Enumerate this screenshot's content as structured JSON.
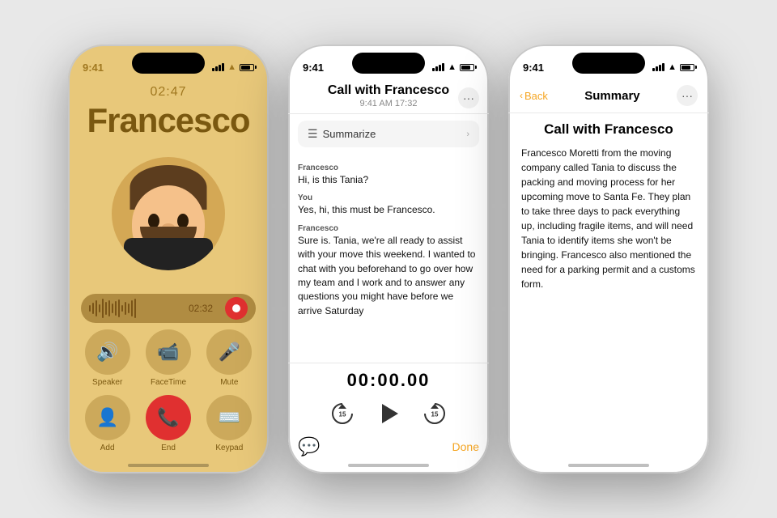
{
  "phone1": {
    "status_time": "9:41",
    "call_duration": "02:47",
    "caller_name": "Francesco",
    "timer": "02:32",
    "buttons": [
      {
        "icon": "🔊",
        "label": "Speaker"
      },
      {
        "icon": "📹",
        "label": "FaceTime"
      },
      {
        "icon": "🎤",
        "label": "Mute"
      },
      {
        "icon": "👤",
        "label": "Add"
      },
      {
        "icon": "📞",
        "label": "End",
        "type": "end"
      },
      {
        "icon": "⌨️",
        "label": "Keypad"
      }
    ]
  },
  "phone2": {
    "status_time": "9:41",
    "title": "Call with Francesco",
    "subtitle": "9:41 AM  17:32",
    "summarize_label": "Summarize",
    "transcript": [
      {
        "speaker": "Francesco",
        "text": "Hi, is this Tania?"
      },
      {
        "speaker": "You",
        "text": "Yes, hi, this must be Francesco."
      },
      {
        "speaker": "Francesco",
        "text": "Sure is. Tania, we're all ready to assist with your move this weekend. I wanted to chat with you beforehand to go over how my team and I work and to answer any questions you might have before we arrive Saturday"
      }
    ],
    "playback_time": "00:00.00",
    "done_label": "Done"
  },
  "phone3": {
    "status_time": "9:41",
    "nav_title": "Summary",
    "back_label": "Back",
    "call_title": "Call with Francesco",
    "summary_text": "Francesco Moretti from the moving company called Tania to discuss the packing and moving process for her upcoming move to Santa Fe. They plan to take three days to pack everything up, including fragile items, and will need Tania to identify items she won't be bringing. Francesco also mentioned the need for a parking permit and a customs form."
  }
}
